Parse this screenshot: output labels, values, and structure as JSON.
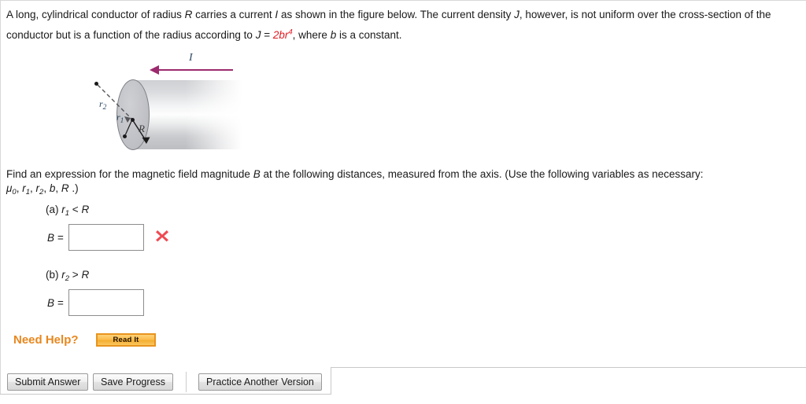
{
  "statement": {
    "line1_a": "A long, cylindrical conductor of radius ",
    "var_R": "R",
    "line1_b": " carries a current ",
    "var_I": "I",
    "line1_c": " as shown in the figure below. The current density ",
    "var_J": "J",
    "line1_d": ", however, is not uniform over the cross-section of the conductor but is a function of the radius according to ",
    "equation_lhs": "J",
    "equation_eq": " = ",
    "equation_rhs_base": "2br",
    "equation_rhs_exp": "4",
    "line1_e": ", where ",
    "var_b": "b",
    "line1_f": " is a constant."
  },
  "figure": {
    "current_label": "I",
    "radius_outer_label": "r",
    "radius_outer_sub": "2",
    "radius_inner_label": "r",
    "radius_inner_sub": "1",
    "radius_label": "R",
    "arrow_color": "#9c2a6e",
    "label_color": "#2c4a63",
    "cylinder_edge_color": "#7e7f85"
  },
  "prompt": {
    "text_a": "Find an expression for the magnetic field magnitude ",
    "var_B": "B",
    "text_b": " at the following distances, measured from the axis. (Use the following variables as necessary: ",
    "variables": {
      "mu": "μ",
      "mu_sub": "0",
      "r1": "r",
      "r1_sub": "1",
      "r2": "r",
      "r2_sub": "2",
      "b": "b",
      "R": "R",
      "trailing": " .)"
    }
  },
  "parts": [
    {
      "id": "a",
      "label_prefix": "(a) ",
      "var": "r",
      "var_sub": "1",
      "relation": " < ",
      "bound": "R",
      "answer_prefix": "B =",
      "answer_value": "",
      "answer_placeholder": "",
      "graded": true,
      "grade_icon": "x-mark-icon",
      "grade_color": "#ef4a52"
    },
    {
      "id": "b",
      "label_prefix": "(b) ",
      "var": "r",
      "var_sub": "2",
      "relation": " > ",
      "bound": "R",
      "answer_prefix": "B =",
      "answer_value": "",
      "answer_placeholder": "",
      "graded": false,
      "grade_icon": "",
      "grade_color": ""
    }
  ],
  "need_help": {
    "label": "Need Help?",
    "label_color": "#e8871e",
    "read_it_label": "Read It",
    "read_it_border_color": "#e8941f"
  },
  "footer": {
    "submit_label": "Submit Answer",
    "save_label": "Save Progress",
    "practice_label": "Practice Another Version"
  }
}
